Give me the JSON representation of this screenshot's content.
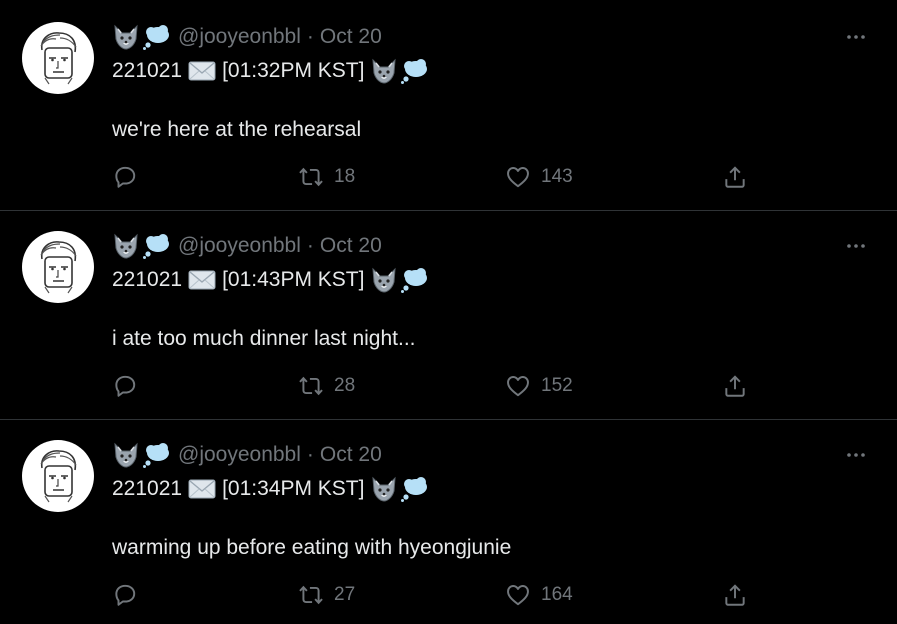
{
  "tweets": [
    {
      "handle": "@jooyeonbbl",
      "separator": "·",
      "date": "Oct 20",
      "code": "221021",
      "time": "[01:32PM KST]",
      "text": "we're here at the rehearsal",
      "retweets": "18",
      "likes": "143"
    },
    {
      "handle": "@jooyeonbbl",
      "separator": "·",
      "date": "Oct 20",
      "code": "221021",
      "time": "[01:43PM KST]",
      "text": "i ate too much dinner last night...",
      "retweets": "28",
      "likes": "152"
    },
    {
      "handle": "@jooyeonbbl",
      "separator": "·",
      "date": "Oct 20",
      "code": "221021",
      "time": "[01:34PM KST]",
      "text": "warming up before eating with hyeongjunie",
      "retweets": "27",
      "likes": "164"
    }
  ],
  "icons": {
    "more": "more-icon",
    "reply": "reply-icon",
    "retweet": "retweet-icon",
    "like": "heart-icon",
    "share": "share-icon",
    "name_emoji": [
      "wolf-emoji-icon",
      "thought-bubble-emoji-icon"
    ],
    "mail": "envelope-emoji-icon"
  },
  "colors": {
    "background": "#000000",
    "text": "#e7e9ea",
    "muted": "#71767b",
    "divider": "#2f3336"
  }
}
